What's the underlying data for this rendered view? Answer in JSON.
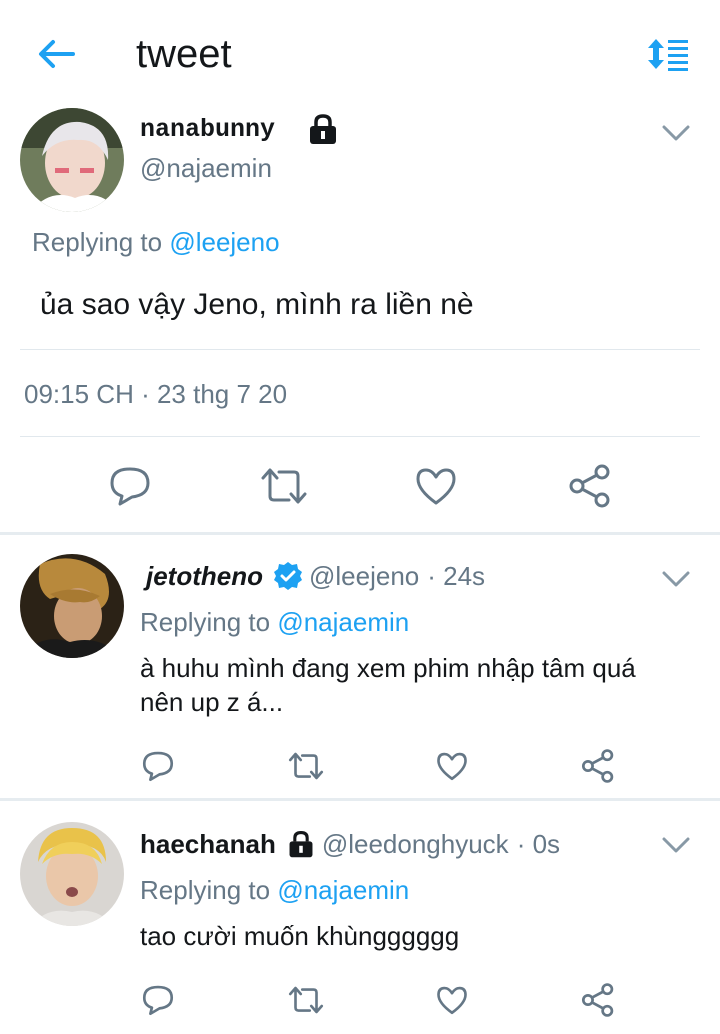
{
  "header": {
    "title": "tweet"
  },
  "main_tweet": {
    "display_name": "nanabunny",
    "handle": "@najaemin",
    "replying_label": "Replying to",
    "replying_to": "@leejeno",
    "text": "ủa sao vậy Jeno, mình ra liền nè",
    "timestamp": "09:15 CH · 23 thg 7 20"
  },
  "replies": [
    {
      "display_name": "jetotheno",
      "handle": "@leejeno",
      "time": "· 24s",
      "replying_label": "Replying to",
      "replying_to": "@najaemin",
      "text_line1": "à huhu mình đang xem phim nhập tâm quá",
      "text_line2": "nên up z á..."
    },
    {
      "display_name": "haechanah",
      "handle": "@leedonghyuck",
      "time": "· 0s",
      "replying_label": "Replying to",
      "replying_to": "@najaemin",
      "text_line1": "tao cười muốn khùngggggg"
    }
  ],
  "colors": {
    "accent": "#1da1f2",
    "secondary_text": "#657786",
    "icon": "#657786"
  }
}
